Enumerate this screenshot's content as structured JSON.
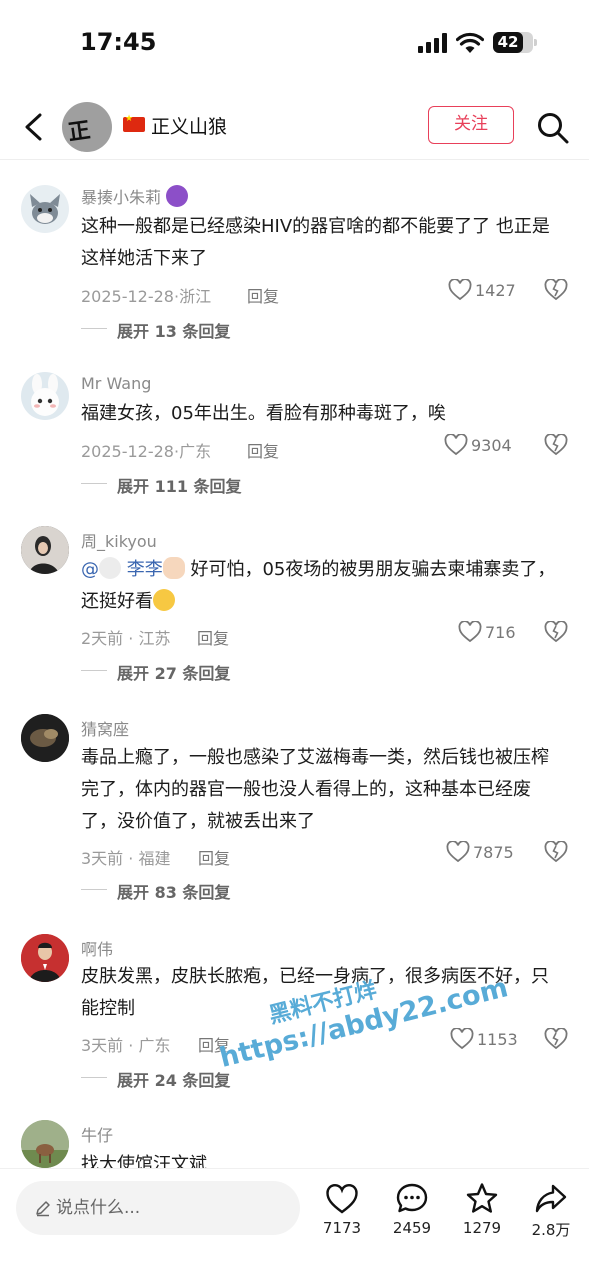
{
  "status_bar": {
    "time": "17:45",
    "battery": "42"
  },
  "header": {
    "title": "正义山狼",
    "follow_label": "关注"
  },
  "comments": [
    {
      "username": "暴揍小朱莉",
      "text": "这种一般都是已经感染HIV的器官啥的都不能要了了 也正是这样她活下来了",
      "date": "2025-12-28",
      "location": "浙江",
      "reply_label": "回复",
      "likes": "1427",
      "expand_label": "展开 13 条回复"
    },
    {
      "username": "Mr Wang",
      "text": "福建女孩，05年出生。看脸有那种毒斑了，唉",
      "date": "2025-12-28",
      "location": "广东",
      "reply_label": "回复",
      "likes": "9304",
      "expand_label": "展开 111 条回复"
    },
    {
      "username": "周_kikyou",
      "mention": "@",
      "mention_name": "李李",
      "text": " 好可怕，05夜场的被男朋友骗去柬埔寨卖了，还挺好看",
      "date": "2天前",
      "location": "江苏",
      "reply_label": "回复",
      "likes": "716",
      "expand_label": "展开 27 条回复"
    },
    {
      "username": "猜窝座",
      "text": "毒品上瘾了，一般也感染了艾滋梅毒一类，然后钱也被压榨完了，体内的器官一般也没人看得上的，这种基本已经废了，没价值了，就被丢出来了",
      "date": "3天前",
      "location": "福建",
      "reply_label": "回复",
      "likes": "7875",
      "expand_label": "展开 83 条回复"
    },
    {
      "username": "啊伟",
      "text": "皮肤发黑，皮肤长脓疱，已经一身病了，很多病医不好，只能控制",
      "date": "3天前",
      "location": "广东",
      "reply_label": "回复",
      "likes": "1153",
      "expand_label": "展开 24 条回复"
    },
    {
      "username": "牛仔",
      "text": "找大使馆汪文斌"
    }
  ],
  "watermark": {
    "line1": "黑料不打烊",
    "line2": "https://abdy22.com"
  },
  "bottom_bar": {
    "input_placeholder": "说点什么...",
    "likes": "7173",
    "comments": "2459",
    "favorites": "1279",
    "shares": "2.8万"
  },
  "icons": [
    "back-arrow-icon",
    "search-icon",
    "heart-icon",
    "dislike-heart-icon",
    "chevron-down-icon",
    "pencil-icon",
    "comment-bubble-icon",
    "star-icon",
    "share-arrow-icon"
  ],
  "colors": {
    "follow_accent": "#e8405a",
    "mention": "#3a66b0",
    "watermark": "#2e96cd"
  }
}
